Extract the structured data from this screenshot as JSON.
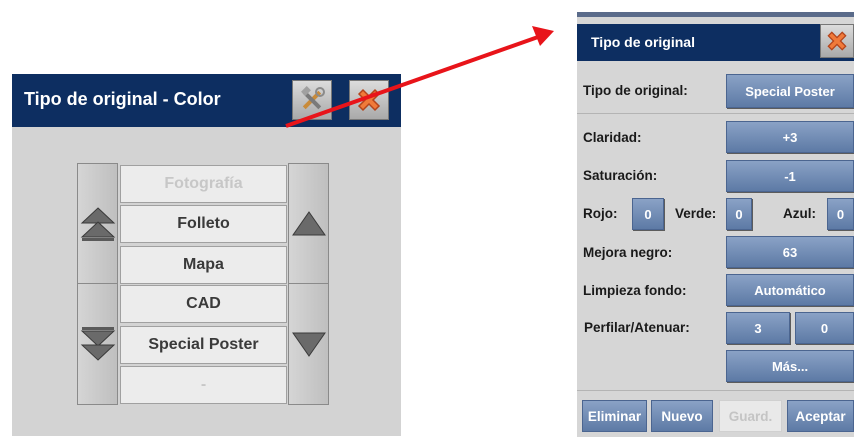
{
  "left": {
    "title": "Tipo de original - Color",
    "items": [
      {
        "label": "Fotografía",
        "state": "disabled"
      },
      {
        "label": "Folleto",
        "state": "enabled"
      },
      {
        "label": "Mapa",
        "state": "enabled"
      },
      {
        "label": "CAD",
        "state": "enabled"
      },
      {
        "label": "Special Poster",
        "state": "enabled"
      },
      {
        "label": "-",
        "state": "disabled"
      }
    ],
    "icons": {
      "tools": "tools-icon",
      "close": "close-icon",
      "scroll_top": "double-up-arrow-icon",
      "scroll_up": "up-arrow-icon",
      "scroll_bottom": "double-down-arrow-icon",
      "scroll_down": "down-arrow-icon"
    }
  },
  "right": {
    "title": "Tipo de original",
    "tipo_label": "Tipo de original:",
    "tipo_value": "Special Poster",
    "claridad_label": "Claridad:",
    "claridad_value": "+3",
    "saturacion_label": "Saturación:",
    "saturacion_value": "-1",
    "rojo_label": "Rojo:",
    "rojo_value": "0",
    "verde_label": "Verde:",
    "verde_value": "0",
    "azul_label": "Azul:",
    "azul_value": "0",
    "mejora_label": "Mejora negro:",
    "mejora_value": "63",
    "limpieza_label": "Limpieza fondo:",
    "limpieza_value": "Automático",
    "perfilar_label": "Perfilar/Atenuar:",
    "perfilar_value_1": "3",
    "perfilar_value_2": "0",
    "mas_label": "Más...",
    "eliminar_label": "Eliminar",
    "nuevo_label": "Nuevo",
    "guard_label": "Guard.",
    "aceptar_label": "Aceptar"
  },
  "colors": {
    "header": "#0d2e61",
    "button_blue": "#6f8cb8",
    "annotation_arrow": "#e8141a"
  }
}
